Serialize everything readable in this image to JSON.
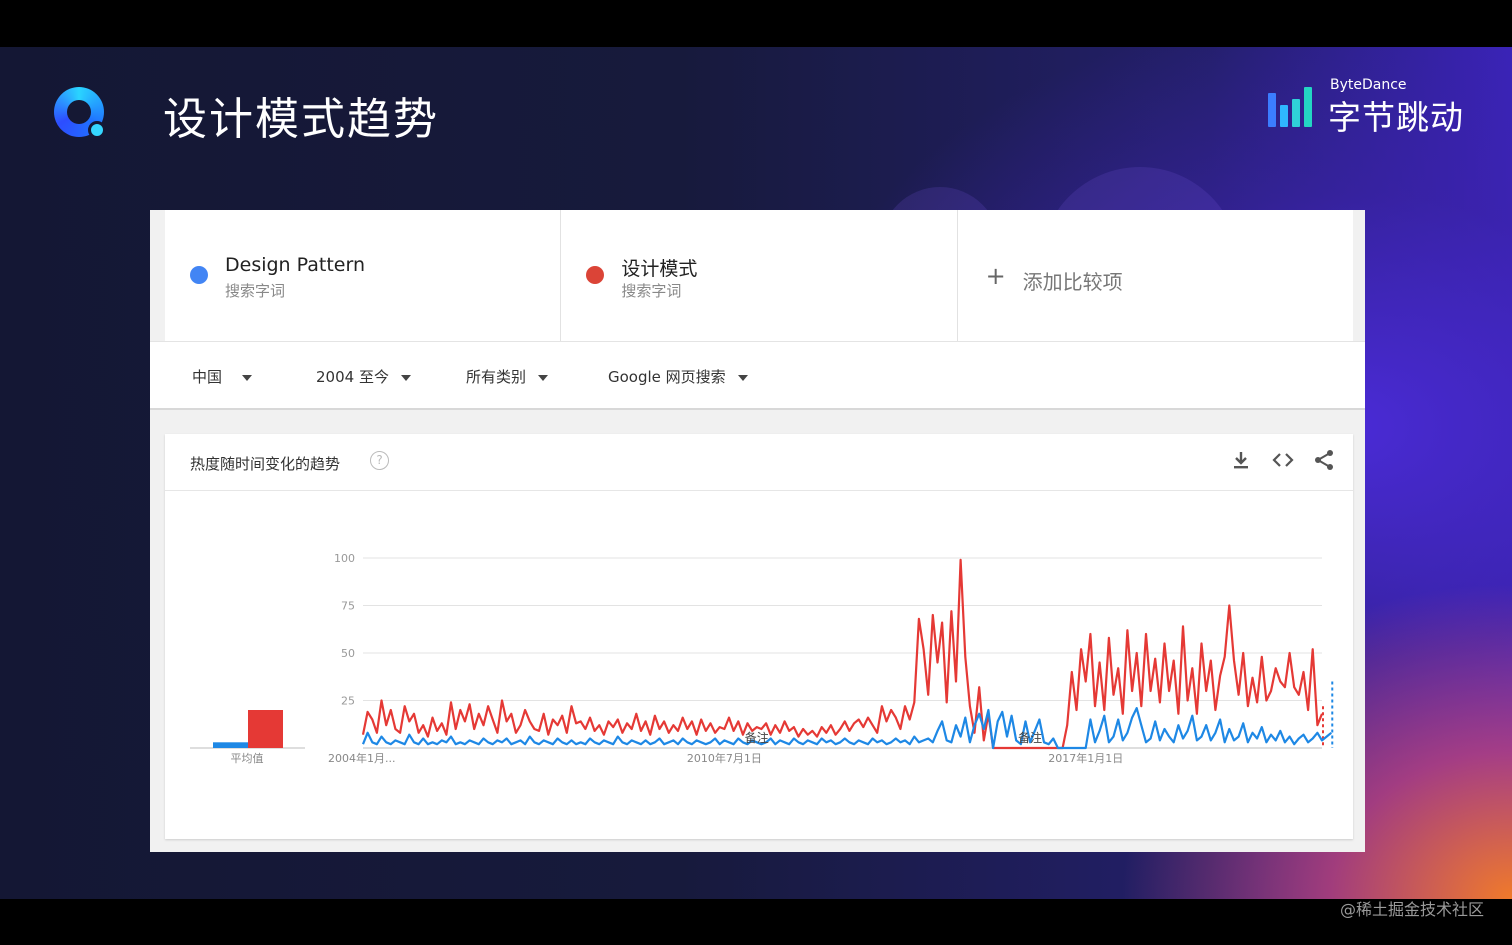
{
  "slide": {
    "title": "设计模式趋势",
    "brand_small": "ByteDance",
    "brand_big": "字节跳动",
    "watermark": "@稀土掘金技术社区"
  },
  "terms": [
    {
      "name": "Design Pattern",
      "sub": "搜索字词",
      "color": "#4285f4"
    },
    {
      "name": "设计模式",
      "sub": "搜索字词",
      "color": "#db4437"
    }
  ],
  "add_compare": "添加比较项",
  "filters": [
    "中国",
    "2004 至今",
    "所有类别",
    "Google 网页搜索"
  ],
  "panel": {
    "title": "热度随时间变化的趋势",
    "help": "?",
    "actions": [
      "download-icon",
      "embed-icon",
      "share-icon"
    ]
  },
  "chart_data": {
    "type": "line",
    "xlabel": "",
    "ylabel": "",
    "ylim": [
      0,
      100
    ],
    "y_ticks": [
      25,
      50,
      75,
      100
    ],
    "x_tick_labels": [
      "2004年1月...",
      "2010年7月1日",
      "2017年1月1日"
    ],
    "x_tick_positions": [
      0,
      78,
      156
    ],
    "annotations": [
      {
        "label": "备注",
        "at": 85
      },
      {
        "label": "备注",
        "at": 144
      }
    ],
    "average": {
      "label": "平均值",
      "values": [
        3,
        20
      ]
    },
    "series": [
      {
        "name": "Design Pattern",
        "color": "#1e88e5",
        "values": [
          2,
          8,
          3,
          2,
          6,
          3,
          2,
          4,
          3,
          2,
          7,
          3,
          2,
          5,
          2,
          3,
          2,
          4,
          3,
          6,
          2,
          3,
          2,
          4,
          3,
          2,
          5,
          3,
          2,
          4,
          3,
          5,
          2,
          3,
          4,
          2,
          6,
          3,
          2,
          4,
          3,
          2,
          5,
          3,
          2,
          4,
          2,
          3,
          2,
          5,
          3,
          2,
          4,
          3,
          2,
          6,
          3,
          2,
          4,
          3,
          2,
          4,
          2,
          3,
          5,
          2,
          3,
          4,
          2,
          5,
          3,
          2,
          4,
          3,
          2,
          3,
          5,
          2,
          4,
          3,
          2,
          5,
          3,
          2,
          4,
          3,
          2,
          3,
          5,
          2,
          4,
          3,
          2,
          5,
          3,
          2,
          4,
          3,
          2,
          5,
          3,
          4,
          2,
          3,
          5,
          3,
          2,
          4,
          3,
          2,
          5,
          3,
          4,
          2,
          3,
          5,
          3,
          4,
          2,
          6,
          3,
          4,
          5,
          3,
          9,
          14,
          4,
          3,
          12,
          6,
          16,
          3,
          12,
          18,
          10,
          20,
          0,
          14,
          19,
          6,
          17,
          4,
          2,
          14,
          3,
          9,
          15,
          3,
          2,
          5,
          0,
          0,
          0,
          0,
          0,
          0,
          0,
          15,
          3,
          9,
          17,
          3,
          6,
          15,
          4,
          8,
          16,
          21,
          12,
          3,
          5,
          14,
          4,
          10,
          6,
          3,
          12,
          5,
          9,
          17,
          4,
          6,
          12,
          4,
          8,
          15,
          3,
          10,
          4,
          6,
          13,
          3,
          8,
          5,
          11,
          3,
          7,
          4,
          9,
          3,
          6,
          2,
          5,
          7,
          3,
          5,
          8,
          4,
          6,
          8
        ],
        "dashed_tail": 14
      },
      {
        "name": "设计模式",
        "color": "#e53935",
        "values": [
          7,
          19,
          15,
          8,
          25,
          12,
          20,
          10,
          8,
          22,
          14,
          18,
          8,
          12,
          6,
          16,
          9,
          13,
          7,
          24,
          10,
          20,
          14,
          23,
          10,
          18,
          12,
          22,
          15,
          8,
          25,
          14,
          18,
          8,
          12,
          20,
          14,
          10,
          9,
          18,
          7,
          15,
          12,
          17,
          8,
          22,
          13,
          14,
          10,
          16,
          9,
          12,
          7,
          14,
          11,
          15,
          8,
          13,
          10,
          18,
          9,
          14,
          7,
          17,
          10,
          14,
          8,
          12,
          9,
          16,
          10,
          14,
          7,
          15,
          9,
          13,
          8,
          11,
          10,
          16,
          9,
          14,
          7,
          13,
          9,
          11,
          10,
          13,
          7,
          12,
          8,
          14,
          9,
          11,
          6,
          10,
          7,
          9,
          6,
          11,
          8,
          12,
          7,
          10,
          14,
          9,
          13,
          15,
          11,
          16,
          12,
          8,
          22,
          14,
          20,
          16,
          10,
          22,
          15,
          24,
          68,
          52,
          28,
          70,
          45,
          66,
          24,
          72,
          35,
          99,
          48,
          22,
          8,
          32,
          4,
          18,
          0,
          0,
          0,
          0,
          0,
          0,
          0,
          0,
          0,
          0,
          0,
          0,
          0,
          0,
          0,
          0,
          12,
          40,
          20,
          52,
          35,
          60,
          22,
          45,
          20,
          58,
          28,
          42,
          18,
          62,
          30,
          50,
          22,
          60,
          30,
          47,
          24,
          55,
          30,
          46,
          18,
          64,
          25,
          42,
          18,
          55,
          30,
          46,
          20,
          38,
          48,
          75,
          46,
          28,
          50,
          22,
          37,
          24,
          48,
          25,
          30,
          42,
          35,
          32,
          50,
          32,
          28,
          40,
          20,
          52,
          12,
          18
        ]
      }
    ]
  }
}
